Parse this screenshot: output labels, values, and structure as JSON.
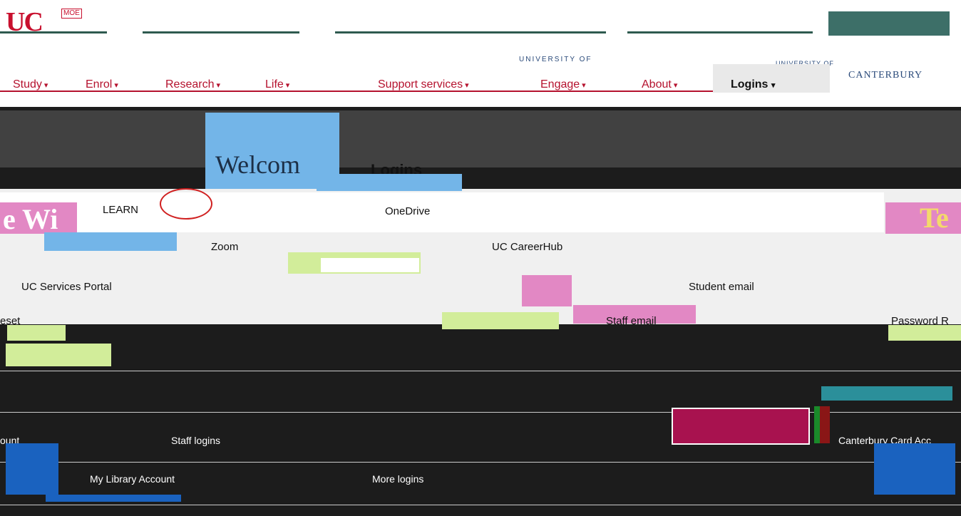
{
  "brand": {
    "logo": "UC",
    "maori_mark": "MOE",
    "university_of": "UNIVERSITY OF",
    "name": "CANTERBURY"
  },
  "nav": {
    "items": [
      "Study",
      "Enrol",
      "Research",
      "Life",
      "Support services",
      "Engage",
      "About"
    ],
    "login_tab": "Logins"
  },
  "hero": {
    "welcome": "Welcom",
    "left_banner": "e Wi",
    "right_banner": "Te"
  },
  "logins_panel": {
    "title": "Logins",
    "links": {
      "learn": "LEARN",
      "onedrive": "OneDrive",
      "zoom": "Zoom",
      "careerhub": "UC CareerHub",
      "services_portal": "UC Services Portal",
      "student_email": "Student email",
      "staff_email": "Staff email",
      "password_reset": "Password R",
      "reset_fragment": "eset"
    }
  },
  "footer": {
    "staff_logins": "Staff logins",
    "my_library": "My Library Account",
    "more_logins": "More logins",
    "canterbury_card": "Canterbury Card Acc",
    "account_fragment": "ount"
  },
  "colors": {
    "uc_red": "#c8102e",
    "nav_red": "#b5122e",
    "hero_dark": "#1c1c1c",
    "sky_blue": "#73b5e8",
    "pink": "#e288c4",
    "lime": "#d2ed9a",
    "crimson": "#a8124f",
    "royal_blue": "#1a62bf",
    "teal": "#3d6f68"
  }
}
